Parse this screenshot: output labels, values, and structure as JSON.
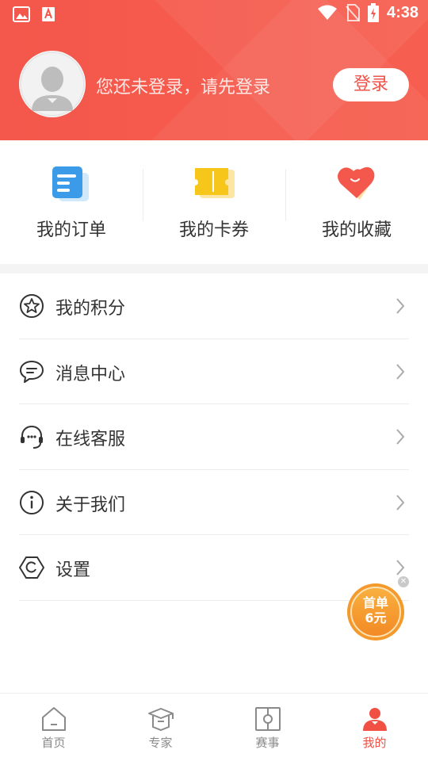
{
  "status_bar": {
    "time": "4:38"
  },
  "header": {
    "login_hint": "您还未登录，请先登录",
    "login_button": "登录"
  },
  "quick_actions": [
    {
      "label": "我的订单",
      "icon": "orders-icon"
    },
    {
      "label": "我的卡券",
      "icon": "coupon-icon"
    },
    {
      "label": "我的收藏",
      "icon": "heart-icon"
    }
  ],
  "menu": [
    {
      "label": "我的积分",
      "icon": "star-icon"
    },
    {
      "label": "消息中心",
      "icon": "message-icon"
    },
    {
      "label": "在线客服",
      "icon": "headset-icon"
    },
    {
      "label": "关于我们",
      "icon": "info-icon"
    },
    {
      "label": "设置",
      "icon": "settings-icon"
    }
  ],
  "promo": {
    "line1": "首单",
    "line2": "6元"
  },
  "tabs": [
    {
      "label": "首页",
      "icon": "home-icon",
      "active": false
    },
    {
      "label": "专家",
      "icon": "graduation-cap-icon",
      "active": false
    },
    {
      "label": "赛事",
      "icon": "field-icon",
      "active": false
    },
    {
      "label": "我的",
      "icon": "user-icon",
      "active": true
    }
  ],
  "colors": {
    "brand": "#f4574b",
    "active_tab": "#f15144",
    "promo": "#f49a2c"
  }
}
